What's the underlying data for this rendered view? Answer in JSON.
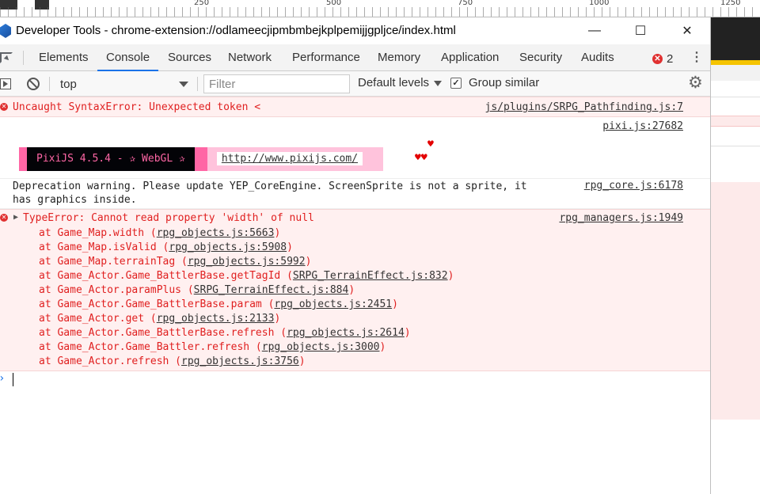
{
  "ruler": {
    "marks": [
      "250",
      "500",
      "750",
      "1000",
      "1250"
    ]
  },
  "window": {
    "title": "Developer Tools - chrome-extension://odlameecjipmbmbejkplpemijjgpljce/index.html",
    "minimize": "—",
    "maximize": "☐",
    "close": "✕"
  },
  "tabs": [
    "Elements",
    "Console",
    "Sources",
    "Network",
    "Performance",
    "Memory",
    "Application",
    "Security",
    "Audits"
  ],
  "active_tab": "Console",
  "error_count": "2",
  "toolbar": {
    "context": "top",
    "filter_placeholder": "Filter",
    "levels": "Default levels",
    "group_similar": "Group similar"
  },
  "messages": {
    "m1": {
      "text": "Uncaught SyntaxError: Unexpected token <",
      "source": "js/plugins/SRPG_Pathfinding.js:7"
    },
    "m2": {
      "source": "pixi.js:27682",
      "banner_text": "PixiJS 4.5.4 - ✰ WebGL ✰",
      "banner_url": "http://www.pixijs.com/",
      "hearts_top": "♥",
      "hearts_bottom": "♥♥"
    },
    "m3": {
      "line1": "Deprecation warning. Please update YEP_CoreEngine. ScreenSprite is not a sprite, it",
      "line2": "has graphics inside.",
      "source": "rpg_core.js:6178"
    },
    "m4": {
      "text": "TypeError: Cannot read property 'width' of null",
      "source": "rpg_managers.js:1949",
      "stack": [
        {
          "fn": "at Game_Map.width (",
          "file": "rpg_objects.js:5663"
        },
        {
          "fn": "at Game_Map.isValid (",
          "file": "rpg_objects.js:5908"
        },
        {
          "fn": "at Game_Map.terrainTag (",
          "file": "rpg_objects.js:5992"
        },
        {
          "fn": "at Game_Actor.Game_BattlerBase.getTagId (",
          "file": "SRPG_TerrainEffect.js:832"
        },
        {
          "fn": "at Game_Actor.paramPlus (",
          "file": "SRPG_TerrainEffect.js:884"
        },
        {
          "fn": "at Game_Actor.Game_BattlerBase.param (",
          "file": "rpg_objects.js:2451"
        },
        {
          "fn": "at Game_Actor.get (",
          "file": "rpg_objects.js:2133"
        },
        {
          "fn": "at Game_Actor.Game_BattlerBase.refresh (",
          "file": "rpg_objects.js:2614"
        },
        {
          "fn": "at Game_Actor.Game_Battler.refresh (",
          "file": "rpg_objects.js:3000"
        },
        {
          "fn": "at Game_Actor.refresh (",
          "file": "rpg_objects.js:3756"
        }
      ]
    }
  },
  "prompt": {
    "chevron": "›"
  },
  "colors": {
    "accent": "#1a73e8",
    "error": "#e02020",
    "error_bg": "#fff0f0",
    "pixi_pink": "#ff66a5"
  }
}
